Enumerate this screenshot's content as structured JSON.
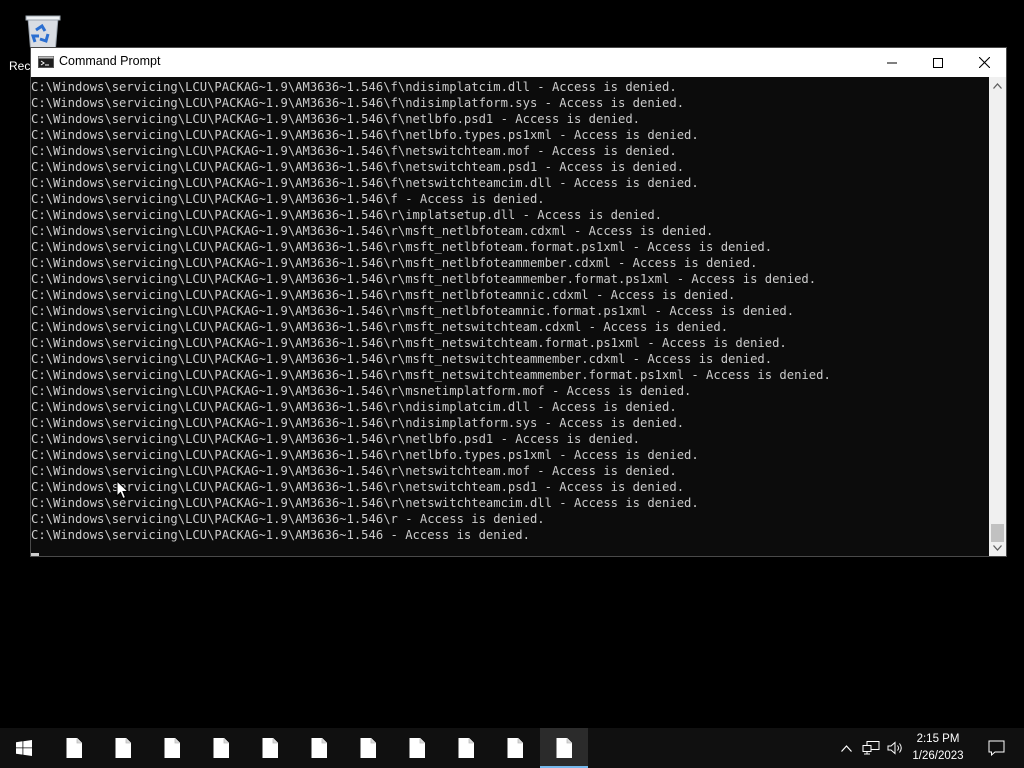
{
  "desktop": {
    "recycle_bin_label": "Rec"
  },
  "window": {
    "title": "Command Prompt",
    "icon": "cmd-icon",
    "buttons": [
      "minimize-icon",
      "maximize-icon",
      "close-icon"
    ]
  },
  "console": {
    "lines": [
      "C:\\Windows\\servicing\\LCU\\PACKAG~1.9\\AM3636~1.546\\f\\ndisimplatcim.dll - Access is denied.",
      "C:\\Windows\\servicing\\LCU\\PACKAG~1.9\\AM3636~1.546\\f\\ndisimplatform.sys - Access is denied.",
      "C:\\Windows\\servicing\\LCU\\PACKAG~1.9\\AM3636~1.546\\f\\netlbfo.psd1 - Access is denied.",
      "C:\\Windows\\servicing\\LCU\\PACKAG~1.9\\AM3636~1.546\\f\\netlbfo.types.ps1xml - Access is denied.",
      "C:\\Windows\\servicing\\LCU\\PACKAG~1.9\\AM3636~1.546\\f\\netswitchteam.mof - Access is denied.",
      "C:\\Windows\\servicing\\LCU\\PACKAG~1.9\\AM3636~1.546\\f\\netswitchteam.psd1 - Access is denied.",
      "C:\\Windows\\servicing\\LCU\\PACKAG~1.9\\AM3636~1.546\\f\\netswitchteamcim.dll - Access is denied.",
      "C:\\Windows\\servicing\\LCU\\PACKAG~1.9\\AM3636~1.546\\f - Access is denied.",
      "C:\\Windows\\servicing\\LCU\\PACKAG~1.9\\AM3636~1.546\\r\\implatsetup.dll - Access is denied.",
      "C:\\Windows\\servicing\\LCU\\PACKAG~1.9\\AM3636~1.546\\r\\msft_netlbfoteam.cdxml - Access is denied.",
      "C:\\Windows\\servicing\\LCU\\PACKAG~1.9\\AM3636~1.546\\r\\msft_netlbfoteam.format.ps1xml - Access is denied.",
      "C:\\Windows\\servicing\\LCU\\PACKAG~1.9\\AM3636~1.546\\r\\msft_netlbfoteammember.cdxml - Access is denied.",
      "C:\\Windows\\servicing\\LCU\\PACKAG~1.9\\AM3636~1.546\\r\\msft_netlbfoteammember.format.ps1xml - Access is denied.",
      "C:\\Windows\\servicing\\LCU\\PACKAG~1.9\\AM3636~1.546\\r\\msft_netlbfoteamnic.cdxml - Access is denied.",
      "C:\\Windows\\servicing\\LCU\\PACKAG~1.9\\AM3636~1.546\\r\\msft_netlbfoteamnic.format.ps1xml - Access is denied.",
      "C:\\Windows\\servicing\\LCU\\PACKAG~1.9\\AM3636~1.546\\r\\msft_netswitchteam.cdxml - Access is denied.",
      "C:\\Windows\\servicing\\LCU\\PACKAG~1.9\\AM3636~1.546\\r\\msft_netswitchteam.format.ps1xml - Access is denied.",
      "C:\\Windows\\servicing\\LCU\\PACKAG~1.9\\AM3636~1.546\\r\\msft_netswitchteammember.cdxml - Access is denied.",
      "C:\\Windows\\servicing\\LCU\\PACKAG~1.9\\AM3636~1.546\\r\\msft_netswitchteammember.format.ps1xml - Access is denied.",
      "C:\\Windows\\servicing\\LCU\\PACKAG~1.9\\AM3636~1.546\\r\\msnetimplatform.mof - Access is denied.",
      "C:\\Windows\\servicing\\LCU\\PACKAG~1.9\\AM3636~1.546\\r\\ndisimplatcim.dll - Access is denied.",
      "C:\\Windows\\servicing\\LCU\\PACKAG~1.9\\AM3636~1.546\\r\\ndisimplatform.sys - Access is denied.",
      "C:\\Windows\\servicing\\LCU\\PACKAG~1.9\\AM3636~1.546\\r\\netlbfo.psd1 - Access is denied.",
      "C:\\Windows\\servicing\\LCU\\PACKAG~1.9\\AM3636~1.546\\r\\netlbfo.types.ps1xml - Access is denied.",
      "C:\\Windows\\servicing\\LCU\\PACKAG~1.9\\AM3636~1.546\\r\\netswitchteam.mof - Access is denied.",
      "C:\\Windows\\servicing\\LCU\\PACKAG~1.9\\AM3636~1.546\\r\\netswitchteam.psd1 - Access is denied.",
      "C:\\Windows\\servicing\\LCU\\PACKAG~1.9\\AM3636~1.546\\r\\netswitchteamcim.dll - Access is denied.",
      "C:\\Windows\\servicing\\LCU\\PACKAG~1.9\\AM3636~1.546\\r - Access is denied.",
      "C:\\Windows\\servicing\\LCU\\PACKAG~1.9\\AM3636~1.546 - Access is denied."
    ],
    "text_color": "#cccccc",
    "background_color": "#0c0c0c"
  },
  "taskbar": {
    "start_icon": "windows-start-icon",
    "items": [
      {
        "icon": "document-icon",
        "active": false
      },
      {
        "icon": "document-icon",
        "active": false
      },
      {
        "icon": "document-icon",
        "active": false
      },
      {
        "icon": "document-icon",
        "active": false
      },
      {
        "icon": "document-icon",
        "active": false
      },
      {
        "icon": "document-icon",
        "active": false
      },
      {
        "icon": "document-icon",
        "active": false
      },
      {
        "icon": "document-icon",
        "active": false
      },
      {
        "icon": "document-icon",
        "active": false
      },
      {
        "icon": "document-icon",
        "active": false
      },
      {
        "icon": "document-icon",
        "active": true
      }
    ],
    "tray_icons": [
      "chevron-up-icon",
      "network-icon",
      "volume-icon"
    ],
    "clock": {
      "time": "2:15 PM",
      "date": "1/26/2023"
    },
    "notification_icon": "action-center-icon",
    "accent_color": "#76b9ed"
  }
}
